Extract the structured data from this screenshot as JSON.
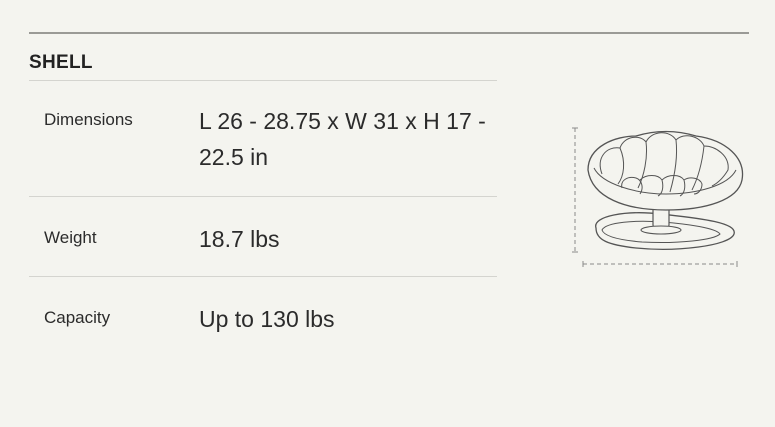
{
  "section": {
    "title": "SHELL"
  },
  "specs": [
    {
      "label": "Dimensions",
      "value": "L 26 - 28.75 x W 31 x H 17 - 22.5 in"
    },
    {
      "label": "Weight",
      "value": "18.7 lbs"
    },
    {
      "label": "Capacity",
      "value": "Up to 130 lbs"
    }
  ],
  "figure": {
    "icon": "shell-chair-dimension-illustration",
    "colors": {
      "line": "#555555",
      "dash": "#8a8a8a",
      "background": "#f4f4ef"
    }
  }
}
